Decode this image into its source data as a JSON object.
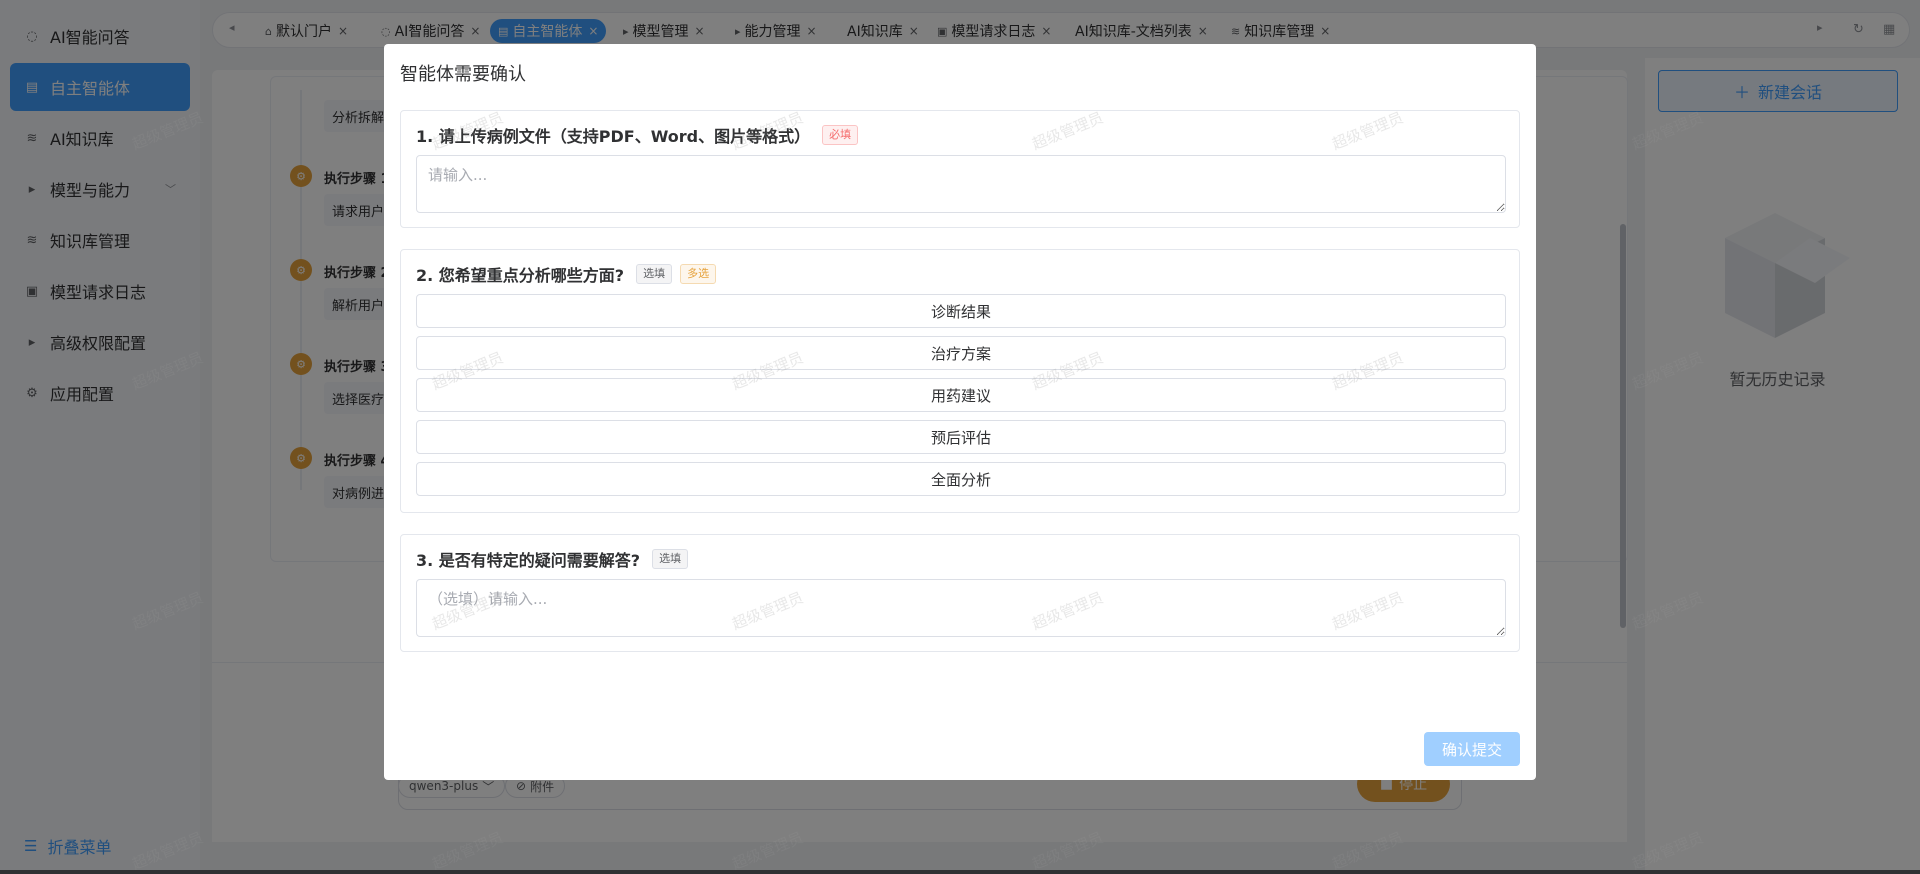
{
  "sidebar": {
    "items": [
      {
        "label": "AI智能问答",
        "icon": "chat-icon"
      },
      {
        "label": "自主智能体",
        "icon": "document-icon"
      },
      {
        "label": "AI知识库",
        "icon": "database-icon"
      },
      {
        "label": "模型与能力",
        "icon": "caret-right-icon"
      },
      {
        "label": "知识库管理",
        "icon": "database-icon"
      },
      {
        "label": "模型请求日志",
        "icon": "log-icon"
      },
      {
        "label": "高级权限配置",
        "icon": "caret-right-icon"
      },
      {
        "label": "应用配置",
        "icon": "gear-icon"
      }
    ],
    "collapse_label": "折叠菜单"
  },
  "tabs": [
    {
      "label": "默认门户",
      "icon": "home-icon"
    },
    {
      "label": "AI智能问答",
      "icon": "chat-icon"
    },
    {
      "label": "自主智能体",
      "icon": "document-icon"
    },
    {
      "label": "模型管理",
      "icon": "caret-right-icon"
    },
    {
      "label": "能力管理",
      "icon": "caret-right-icon"
    },
    {
      "label": "AI知识库",
      "icon": ""
    },
    {
      "label": "模型请求日志",
      "icon": "log-icon"
    },
    {
      "label": "AI知识库-文档列表",
      "icon": ""
    },
    {
      "label": "知识库管理",
      "icon": "database-icon"
    }
  ],
  "background": {
    "step_box_1": "分析拆解",
    "steps": [
      {
        "title": "执行步骤 1",
        "text": "请求用户"
      },
      {
        "title": "执行步骤 2",
        "text": "解析用户"
      },
      {
        "title": "执行步骤 3",
        "text": "选择医疗"
      },
      {
        "title": "执行步骤 4",
        "text": "对病例进"
      }
    ],
    "model_label": "qwen3-plus",
    "attach_label": "附件",
    "send_label": "停止",
    "new_chat_label": "新建会话",
    "empty_history": "暂无历史记录"
  },
  "modal": {
    "title": "智能体需要确认",
    "q1": {
      "title": "1. 请上传病例文件（支持PDF、Word、图片等格式）",
      "tag": "必填",
      "placeholder": "请输入..."
    },
    "q2": {
      "title": "2. 您希望重点分析哪些方面?",
      "tag_optional": "选填",
      "tag_multi": "多选",
      "options": [
        "诊断结果",
        "治疗方案",
        "用药建议",
        "预后评估",
        "全面分析"
      ]
    },
    "q3": {
      "title": "3. 是否有特定的疑问需要解答?",
      "tag": "选填",
      "placeholder": "（选填）请输入..."
    },
    "submit_label": "确认提交"
  },
  "watermark": "超级管理员",
  "colors": {
    "primary": "#409eff",
    "warning": "#e6a23c",
    "danger": "#f56c6c",
    "disabled_primary": "#a0cfff"
  }
}
